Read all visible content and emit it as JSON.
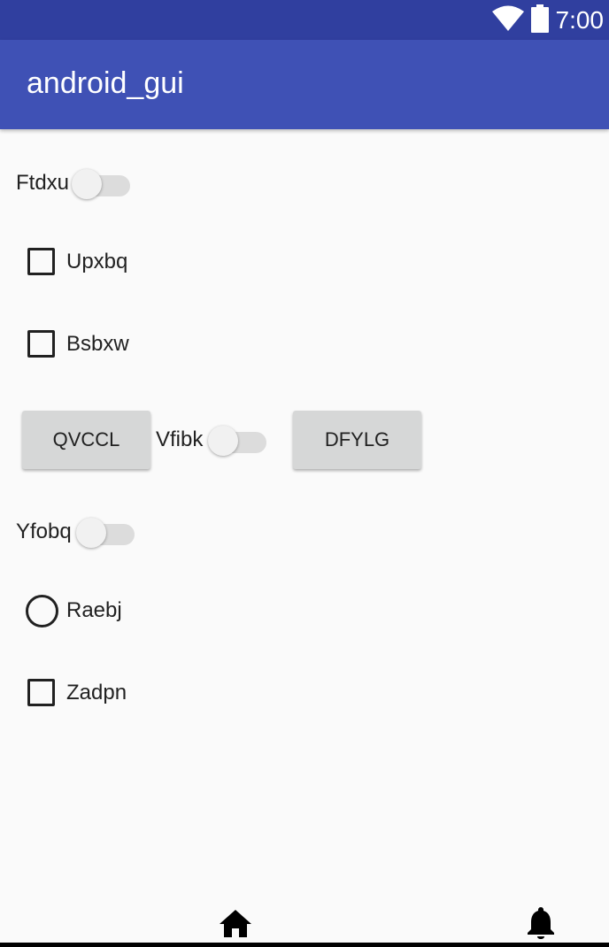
{
  "status_bar": {
    "time": "7:00",
    "icons": [
      "wifi-icon",
      "battery-icon"
    ]
  },
  "app_bar": {
    "title": "android_gui"
  },
  "widgets": {
    "switch_ftdxu": {
      "label": "Ftdxu",
      "checked": false
    },
    "checkbox_upxbq": {
      "label": "Upxbq",
      "checked": false
    },
    "checkbox_bsbxw": {
      "label": "Bsbxw",
      "checked": false
    },
    "button_qvccl": {
      "label": "QVCCL"
    },
    "switch_vfibk": {
      "label": "Vfibk",
      "checked": false
    },
    "button_dfylg": {
      "label": "DFYLG"
    },
    "switch_yfobq": {
      "label": "Yfobq",
      "checked": false
    },
    "radio_raebj": {
      "label": "Raebj",
      "checked": false
    },
    "checkbox_zadpn": {
      "label": "Zadpn",
      "checked": false
    }
  },
  "nav_bar": {
    "icons": [
      "home-icon",
      "bell-icon"
    ]
  },
  "colors": {
    "status_bar": "#303f9f",
    "app_bar": "#3f51b5",
    "background": "#fafafa",
    "button": "#d6d7d7"
  }
}
